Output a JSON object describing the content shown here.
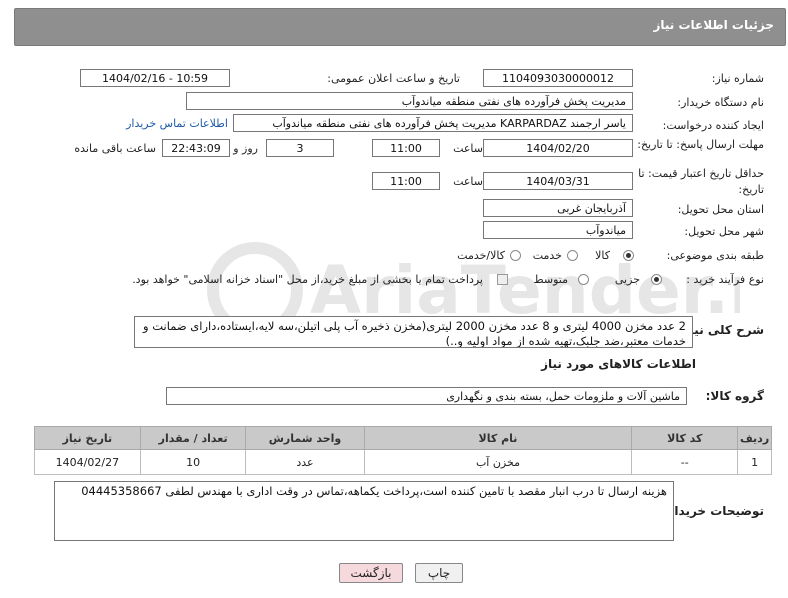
{
  "header": {
    "title": "جزئیات اطلاعات نیاز"
  },
  "fields": {
    "need_number_label": "شماره نیاز:",
    "need_number": "1104093030000012",
    "announce_label": "تاریخ و ساعت اعلان عمومی:",
    "announce_value": "1404/02/16 - 10:59",
    "buyer_org_label": "نام دستگاه خریدار:",
    "buyer_org": "مدیریت پخش فرآورده های نفتی منطقه میاندوآب",
    "creator_label": "ایجاد کننده درخواست:",
    "creator": "یاسر ارجمند KARPARDAZ مدیریت پخش فرآورده های نفتی منطقه میاندوآب",
    "contact_link": "اطلاعات تماس خریدار",
    "reply_deadline_label": "مهلت ارسال پاسخ: تا تاریخ:",
    "reply_date": "1404/02/20",
    "time_label": "ساعت",
    "reply_time": "11:00",
    "days_value": "3",
    "days_label": "روز و",
    "remaining_time": "22:43:09",
    "remaining_label": "ساعت باقی مانده",
    "price_validity_label": "حداقل تاریخ اعتبار قیمت: تا تاریخ:",
    "price_date": "1404/03/31",
    "price_time": "11:00",
    "province_label": "استان محل تحویل:",
    "province": "آذربایجان غربی",
    "city_label": "شهر محل تحویل:",
    "city": "میاندوآب",
    "category_label": "طبقه بندی موضوعی:",
    "category_options": [
      "کالا",
      "خدمت",
      "کالا/خدمت"
    ],
    "category_selected": "کالا",
    "process_label": "نوع فرآیند خرید :",
    "process_options": [
      "جزیی",
      "متوسط"
    ],
    "process_selected": "جزیی",
    "payment_note": "پرداخت تمام یا بخشی از مبلغ خرید،از محل \"اسناد خزانه اسلامی\" خواهد بود.",
    "description_label": "شرح کلی نیاز:",
    "description": "2 عدد مخزن 4000 لیتری و 8 عدد مخزن 2000 لیتری(مخزن ذخیره آب پلی اتیلن،سه لایه،ایستاده،دارای ضمانت و خدمات معتبر،ضد جلبک،تهیه شده از مواد اولیه و..)",
    "goods_info_title": "اطلاعات کالاهای مورد نیاز",
    "goods_group_label": "گروه کالا:",
    "goods_group": "ماشین آلات و ملزومات حمل، بسته بندی و نگهداری",
    "buyer_notes_label": "توضیحات خریدار:",
    "buyer_notes": "هزینه ارسال تا درب انبار مقصد با تامین کننده است،پرداخت یکماهه،تماس در وقت اداری با مهندس لطفی 04445358667"
  },
  "table": {
    "headers": [
      "ردیف",
      "کد کالا",
      "نام کالا",
      "واحد شمارش",
      "تعداد / مقدار",
      "تاریخ نیاز"
    ],
    "rows": [
      [
        "1",
        "--",
        "مخزن آب",
        "عدد",
        "10",
        "1404/02/27"
      ]
    ]
  },
  "buttons": {
    "print": "چاپ",
    "back": "بازگشت"
  },
  "watermark": "AriaTender.neT",
  "colors": {
    "header_bg": "#8f8f8f",
    "table_header_bg": "#c9c9c9",
    "link": "#1e5aa8",
    "back_button_bg": "#f6d9dc"
  }
}
